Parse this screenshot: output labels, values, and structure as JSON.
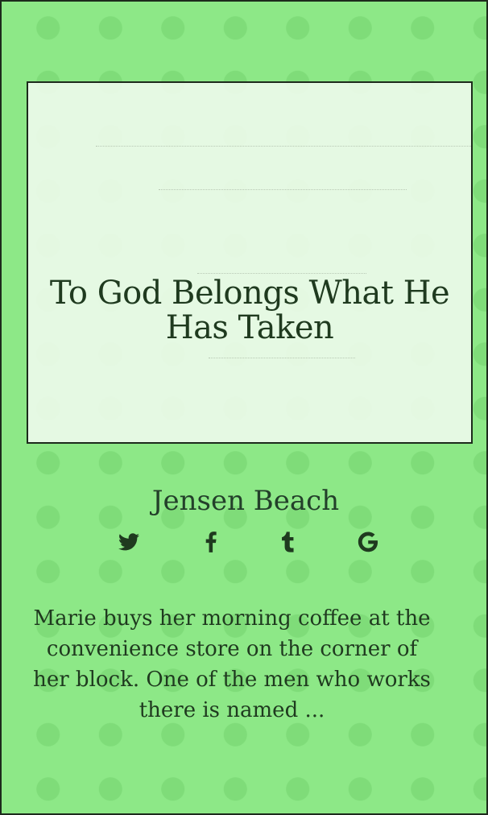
{
  "story": {
    "title": "To God Belongs What He Has Taken",
    "author": "Jensen Beach",
    "excerpt": "Marie buys her morning coffee at the convenience store on the corner of her block. One of the men who works there is named ..."
  },
  "share": [
    {
      "name": "twitter-icon"
    },
    {
      "name": "facebook-icon"
    },
    {
      "name": "tumblr-icon"
    },
    {
      "name": "google-icon"
    }
  ],
  "colors": {
    "background": "#8de887",
    "polka_dot": "#7fdc79",
    "cover_fill": "#ecfae9",
    "text": "#1f3a1f",
    "border": "#1d2b1c"
  }
}
